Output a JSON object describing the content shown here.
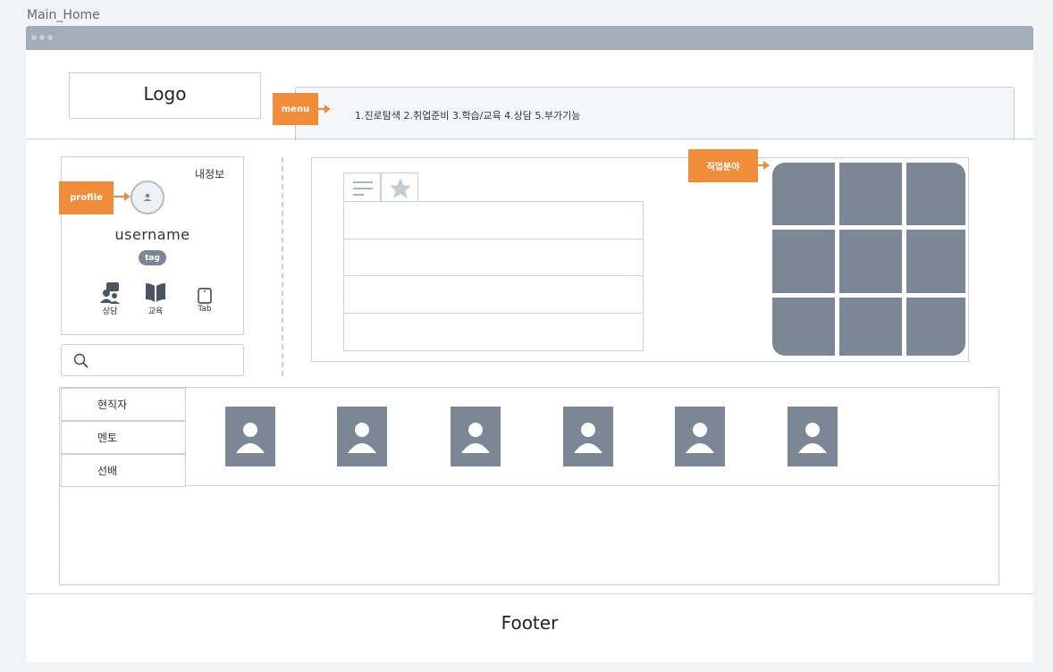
{
  "page_title": "Main_Home",
  "header": {
    "logo": "Logo",
    "menu_callout": "menu",
    "menu_text": "1.진로탐색 2.취업준비 3.학습/교육 4.상담 5.부가기능"
  },
  "profile": {
    "callout": "profile",
    "my_info": "내정보",
    "username": "username",
    "tag": "tag",
    "icons": [
      {
        "label": "상담",
        "icon": "chat-people-icon"
      },
      {
        "label": "교육",
        "icon": "book-icon"
      },
      {
        "label": "Tab",
        "icon": "tablet-icon"
      }
    ]
  },
  "search": {
    "placeholder": "",
    "icon": "search-icon"
  },
  "content": {
    "callout": "직업분야",
    "tabs": [
      {
        "icon": "hamburger-icon"
      },
      {
        "icon": "star-icon"
      }
    ],
    "list_rows": 4,
    "grid_cells": 9
  },
  "people": {
    "menu": [
      "현직자",
      "멘토",
      "선배"
    ],
    "cards": 6
  },
  "footer": "Footer",
  "colors": {
    "accent": "#f08c3a",
    "placeholder_gray": "#7b8794",
    "border": "#c8d0da",
    "titlebar": "#a1adb8"
  }
}
